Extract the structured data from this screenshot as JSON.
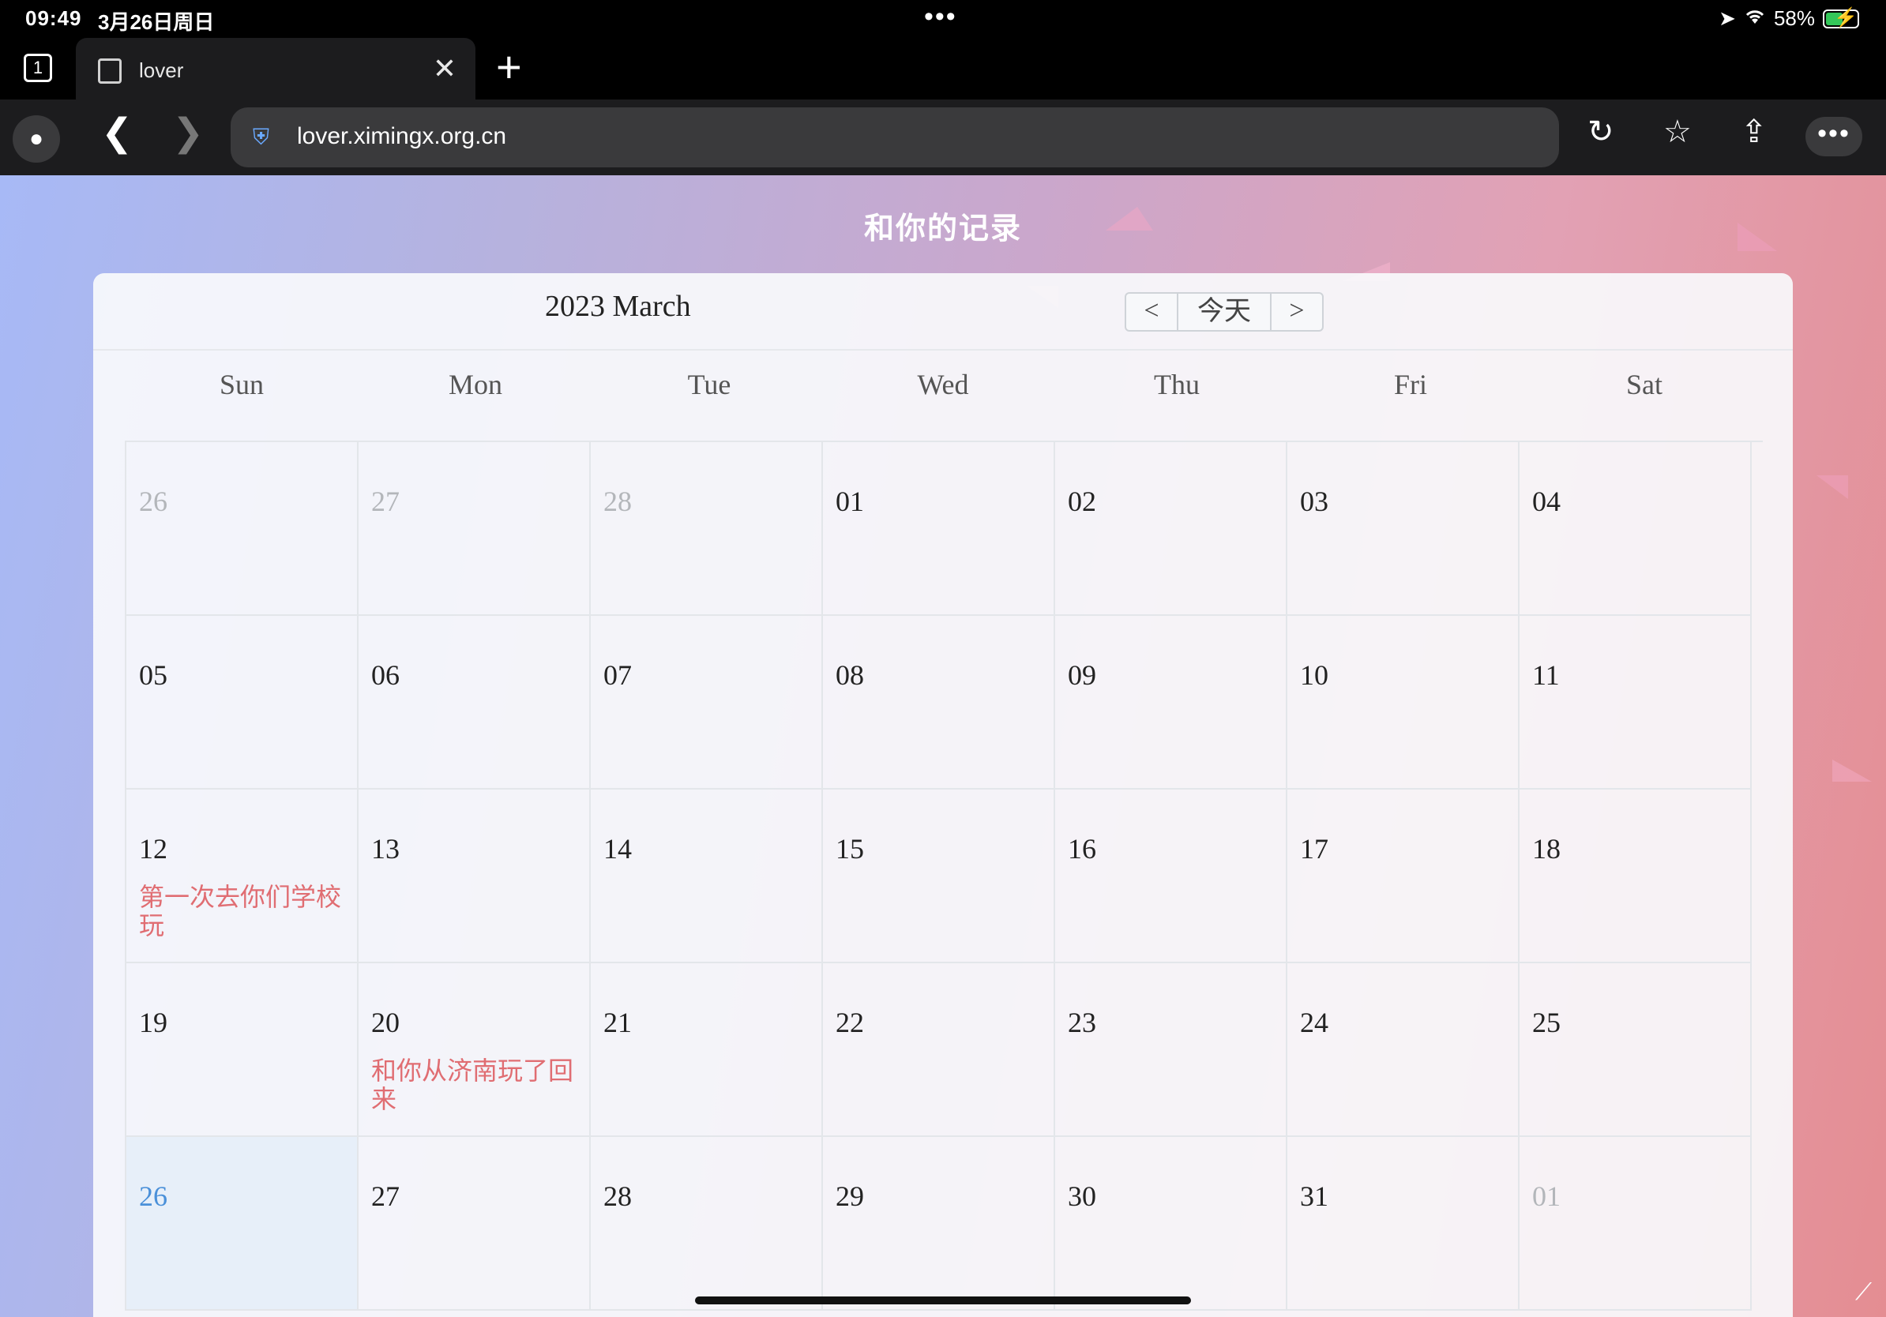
{
  "status": {
    "time": "09:49",
    "date": "3月26日周日",
    "battery": "58%",
    "battery_level": 0.58
  },
  "browser": {
    "tab_count": "1",
    "tab_title": "lover",
    "url": "lover.ximingx.org.cn",
    "icons": [
      "profile-icon",
      "back-icon",
      "forward-icon",
      "shield-icon",
      "reload-icon",
      "favorites-icon",
      "share-icon",
      "more-icon"
    ]
  },
  "page": {
    "title": "和你的记录",
    "calendar": {
      "title": "2023 March",
      "nav": {
        "prev": "<",
        "today": "今天",
        "next": ">"
      },
      "weekdays": [
        "Sun",
        "Mon",
        "Tue",
        "Wed",
        "Thu",
        "Fri",
        "Sat"
      ],
      "days": [
        {
          "num": "26",
          "other": true
        },
        {
          "num": "27",
          "other": true
        },
        {
          "num": "28",
          "other": true
        },
        {
          "num": "01"
        },
        {
          "num": "02"
        },
        {
          "num": "03"
        },
        {
          "num": "04"
        },
        {
          "num": "05"
        },
        {
          "num": "06"
        },
        {
          "num": "07"
        },
        {
          "num": "08"
        },
        {
          "num": "09"
        },
        {
          "num": "10"
        },
        {
          "num": "11"
        },
        {
          "num": "12",
          "event": "第一次去你们学校玩"
        },
        {
          "num": "13"
        },
        {
          "num": "14"
        },
        {
          "num": "15"
        },
        {
          "num": "16"
        },
        {
          "num": "17"
        },
        {
          "num": "18"
        },
        {
          "num": "19"
        },
        {
          "num": "20",
          "event": "和你从济南玩了回来"
        },
        {
          "num": "21"
        },
        {
          "num": "22"
        },
        {
          "num": "23"
        },
        {
          "num": "24"
        },
        {
          "num": "25"
        },
        {
          "num": "26",
          "today": true
        },
        {
          "num": "27"
        },
        {
          "num": "28"
        },
        {
          "num": "29"
        },
        {
          "num": "30"
        },
        {
          "num": "31"
        },
        {
          "num": "01",
          "other": true
        }
      ]
    }
  }
}
